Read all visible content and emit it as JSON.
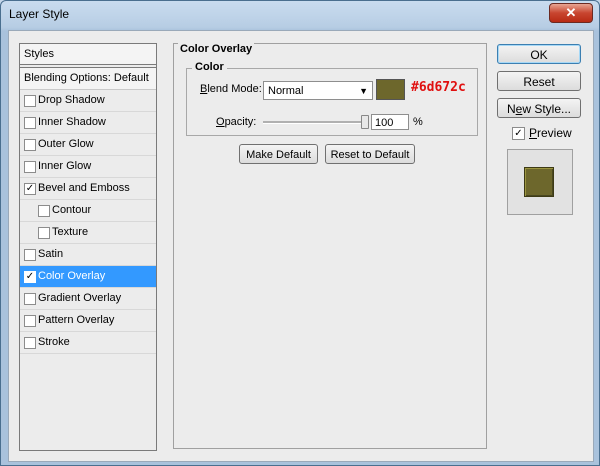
{
  "window": {
    "title": "Layer Style",
    "close_glyph": "✕"
  },
  "styles_panel": {
    "header": "Styles",
    "blending_options": "Blending Options: Default",
    "items": [
      {
        "label": "Drop Shadow",
        "checked": false,
        "indent": false
      },
      {
        "label": "Inner Shadow",
        "checked": false,
        "indent": false
      },
      {
        "label": "Outer Glow",
        "checked": false,
        "indent": false
      },
      {
        "label": "Inner Glow",
        "checked": false,
        "indent": false
      },
      {
        "label": "Bevel and Emboss",
        "checked": true,
        "indent": false
      },
      {
        "label": "Contour",
        "checked": false,
        "indent": true
      },
      {
        "label": "Texture",
        "checked": false,
        "indent": true
      },
      {
        "label": "Satin",
        "checked": false,
        "indent": false
      },
      {
        "label": "Color Overlay",
        "checked": true,
        "indent": false,
        "selected": true
      },
      {
        "label": "Gradient Overlay",
        "checked": false,
        "indent": false
      },
      {
        "label": "Pattern Overlay",
        "checked": false,
        "indent": false
      },
      {
        "label": "Stroke",
        "checked": false,
        "indent": false
      }
    ]
  },
  "color_overlay": {
    "group_title": "Color Overlay",
    "sub_title": "Color",
    "blend_mode_label_prefix": "B",
    "blend_mode_label_rest": "lend Mode:",
    "blend_mode_value": "Normal",
    "swatch_color": "#6d672c",
    "hex_annotation": "#6d672c",
    "opacity_label_prefix": "O",
    "opacity_label_rest": "pacity:",
    "opacity_value": "100",
    "opacity_unit": "%",
    "opacity_fraction": 1.0,
    "make_default": "Make Default",
    "reset_to_default": "Reset to Default"
  },
  "actions": {
    "ok": "OK",
    "reset": "Reset",
    "new_style_prefix": "N",
    "new_style_underlined": "e",
    "new_style_rest": "w Style...",
    "preview_prefix": "",
    "preview_underlined": "P",
    "preview_rest": "review",
    "preview_checked": true
  },
  "preview": {
    "color": "#6d672c"
  }
}
